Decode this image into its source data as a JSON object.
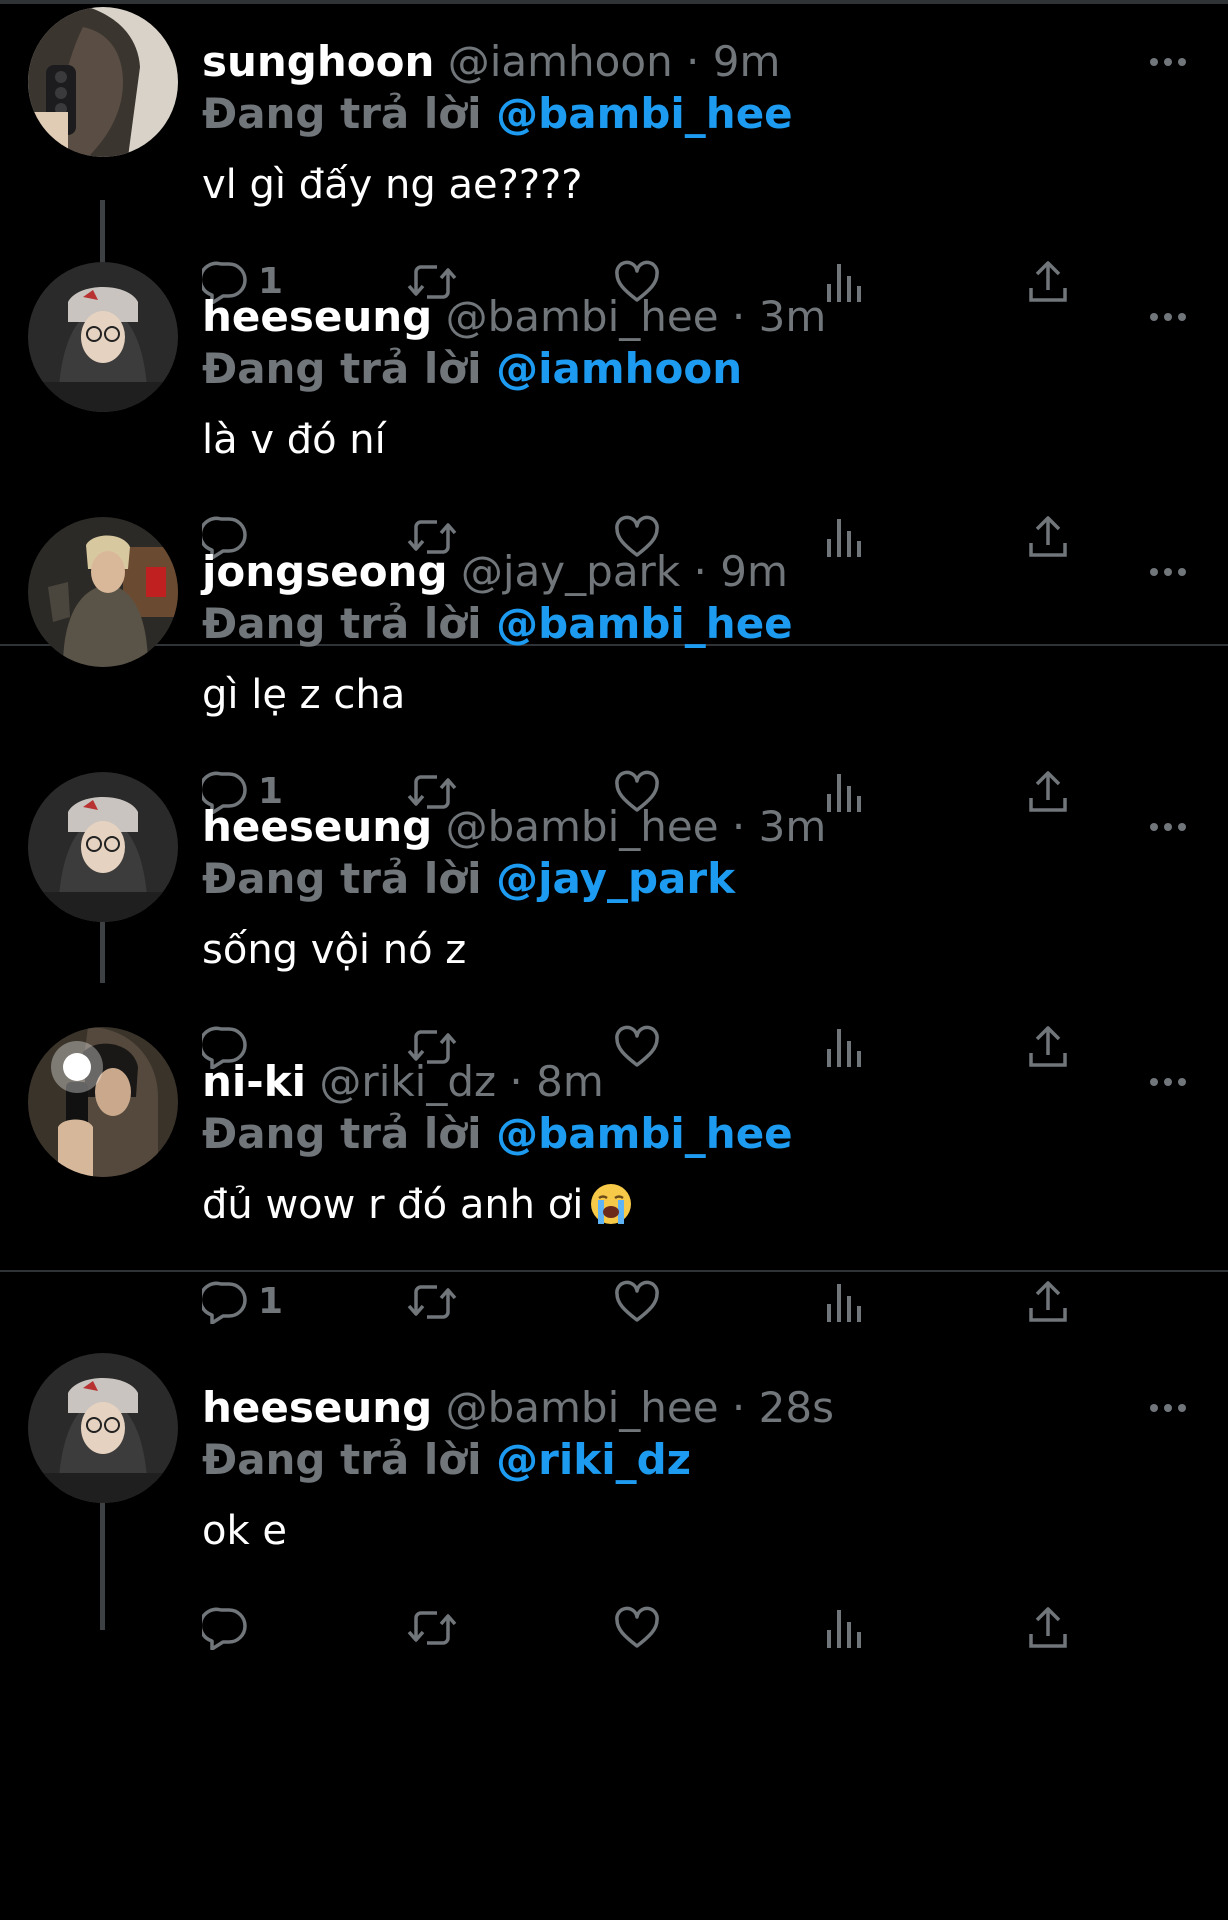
{
  "colors": {
    "background": "#000000",
    "text": "#ffffff",
    "muted": "#71767b",
    "mention": "#1d9bf0",
    "divider": "#2f3336"
  },
  "icons": [
    "reply-icon",
    "retweet-icon",
    "like-icon",
    "views-icon",
    "share-icon",
    "more-icon",
    "loudly-crying-emoji"
  ],
  "tweets": [
    {
      "name": "sunghoon",
      "handle": "@iamhoon",
      "sep": "·",
      "time": "9m",
      "reply_label": "Đang trả lời",
      "reply_to": "@bambi_hee",
      "text": "vl gì đấy ng ae????",
      "reply_count": "1",
      "avatar": "sunghoon-avatar"
    },
    {
      "name": "heeseung",
      "handle": "@bambi_hee",
      "sep": "·",
      "time": "3m",
      "reply_label": "Đang trả lời",
      "reply_to": "@iamhoon",
      "text": "là v đó ní",
      "reply_count": "",
      "avatar": "heeseung-avatar"
    },
    {
      "name": "jongseong",
      "handle": "@jay_park",
      "sep": "·",
      "time": "9m",
      "reply_label": "Đang trả lời",
      "reply_to": "@bambi_hee",
      "text": "gì lẹ z cha",
      "reply_count": "1",
      "avatar": "jongseong-avatar"
    },
    {
      "name": "heeseung",
      "handle": "@bambi_hee",
      "sep": "·",
      "time": "3m",
      "reply_label": "Đang trả lời",
      "reply_to": "@jay_park",
      "text": "sống vội nó z",
      "reply_count": "",
      "avatar": "heeseung-avatar"
    },
    {
      "name": "ni-ki",
      "handle": "@riki_dz",
      "sep": "·",
      "time": "8m",
      "reply_label": "Đang trả lời",
      "reply_to": "@bambi_hee",
      "text": "đủ wow r đó anh ơi",
      "emoji": "loudly-crying-emoji",
      "reply_count": "1",
      "avatar": "niki-avatar"
    },
    {
      "name": "heeseung",
      "handle": "@bambi_hee",
      "sep": "·",
      "time": "28s",
      "reply_label": "Đang trả lời",
      "reply_to": "@riki_dz",
      "text": "ok e",
      "reply_count": "",
      "avatar": "heeseung-avatar"
    }
  ]
}
